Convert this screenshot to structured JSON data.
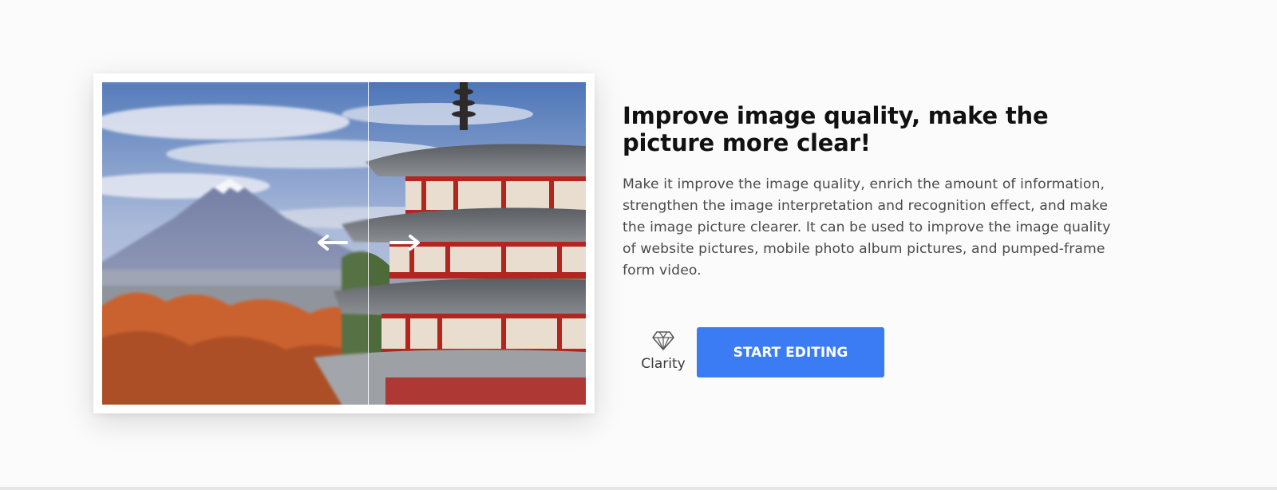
{
  "feature": {
    "headline": "Improve image quality, make the picture more clear!",
    "description": "Make it improve the image quality, enrich the amount of information, strengthen the image interpretation and recognition effect, and make the image picture clearer. It can be used to improve the image quality of website pictures, mobile photo album pictures, and pumped-frame form video.",
    "badge": {
      "icon": "diamond-icon",
      "label": "Clarity"
    },
    "cta_label": "START EDITING"
  },
  "comparison": {
    "divider_position": 0.55,
    "left_icon": "arrow-left-icon",
    "right_icon": "arrow-right-icon"
  },
  "colors": {
    "accent": "#3b7cf5",
    "heading": "#111111",
    "body_text": "#4a4a4a"
  }
}
